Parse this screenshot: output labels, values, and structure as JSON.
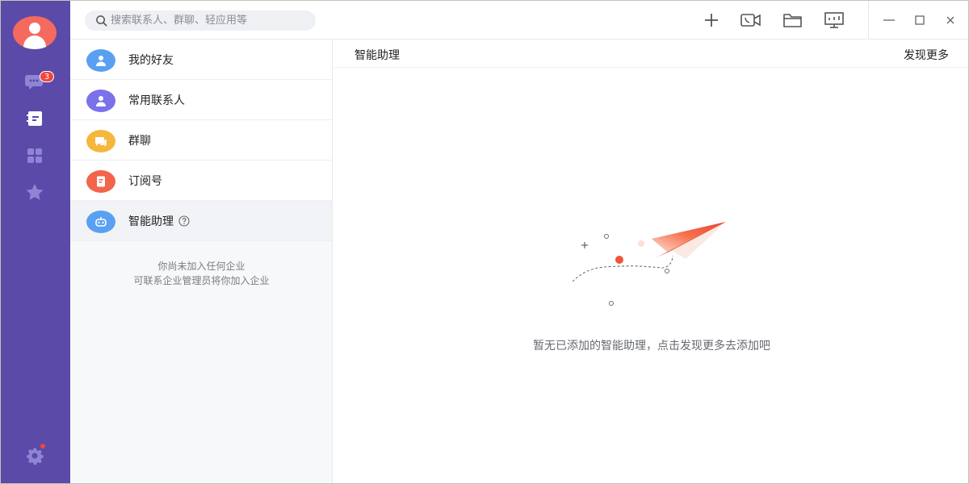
{
  "app": {
    "unread_count": "3"
  },
  "search": {
    "placeholder": "搜索联系人、群聊、轻应用等"
  },
  "rail": {
    "items": [
      {
        "icon": "chat-icon"
      },
      {
        "icon": "contacts-book-icon"
      },
      {
        "icon": "apps-grid-icon"
      },
      {
        "icon": "star-icon"
      },
      {
        "icon": "settings-icon"
      }
    ]
  },
  "toolbar": {
    "icons": [
      "plus-icon",
      "video-call-icon",
      "folder-icon",
      "presentation-icon"
    ],
    "window_controls": [
      "minimize-icon",
      "maximize-icon",
      "close-icon"
    ]
  },
  "contacts": {
    "items": [
      {
        "label": "我的好友",
        "icon": "friend-icon",
        "color": "#5aa0f2"
      },
      {
        "label": "常用联系人",
        "icon": "frequent-contact-icon",
        "color": "#7b71e9"
      },
      {
        "label": "群聊",
        "icon": "group-chat-icon",
        "color": "#f6b73c"
      },
      {
        "label": "订阅号",
        "icon": "subscription-icon",
        "color": "#f2644c"
      },
      {
        "label": "智能助理",
        "icon": "assistant-robot-icon",
        "color": "#5aa0f2"
      }
    ],
    "enterprise_empty": [
      "你尚未加入任何企业",
      "可联系企业管理员将你加入企业"
    ]
  },
  "main": {
    "title": "智能助理",
    "discover_more": "发现更多",
    "empty_message": "暂无已添加的智能助理，点击发现更多去添加吧"
  },
  "colors": {
    "rail_bg": "#5b4aa8",
    "badge": "#f0463c",
    "accent_orange": "#f46a5e"
  }
}
